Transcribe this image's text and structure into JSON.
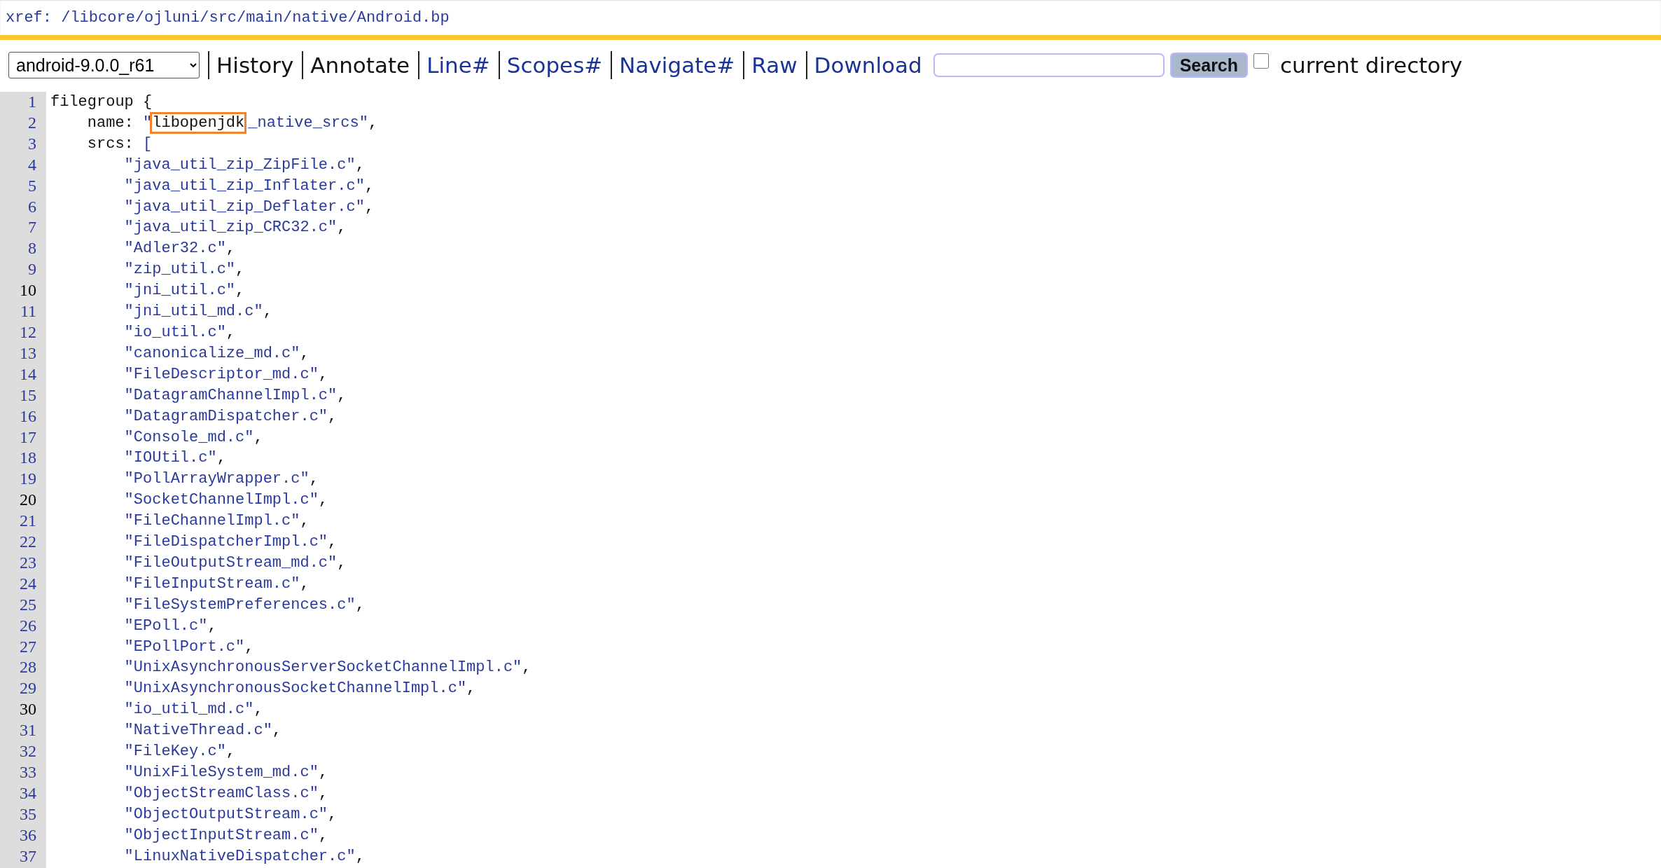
{
  "xref_path": "xref: /libcore/ojluni/src/main/native/Android.bp",
  "toolbar": {
    "version_select": {
      "value": "android-9.0.0_r61"
    },
    "links": [
      {
        "label": "History",
        "kind": "plain"
      },
      {
        "label": "Annotate",
        "kind": "plain"
      },
      {
        "label": "Line#",
        "kind": "link"
      },
      {
        "label": "Scopes#",
        "kind": "link"
      },
      {
        "label": "Navigate#",
        "kind": "link"
      },
      {
        "label": "Raw",
        "kind": "link"
      },
      {
        "label": "Download",
        "kind": "link"
      }
    ],
    "search": {
      "button": "Search"
    },
    "current_directory": {
      "label": "current directory",
      "checked": false
    }
  },
  "code": [
    {
      "number": "1",
      "major": false,
      "tokens": [
        {
          "kind": "plain",
          "text": "filegroup {"
        }
      ]
    },
    {
      "number": "2",
      "major": false,
      "tokens": [
        {
          "kind": "plain",
          "text": "    name: "
        },
        {
          "kind": "string",
          "text": "\""
        },
        {
          "kind": "highlight",
          "text": "libopenjdk"
        },
        {
          "kind": "string",
          "text": "_native_srcs\""
        },
        {
          "kind": "plain",
          "text": ","
        }
      ]
    },
    {
      "number": "3",
      "major": false,
      "tokens": [
        {
          "kind": "plain",
          "text": "    srcs: "
        },
        {
          "kind": "string",
          "text": "["
        }
      ]
    },
    {
      "number": "4",
      "major": false,
      "tokens": [
        {
          "kind": "string",
          "text": "        \"java_util_zip_ZipFile.c\""
        },
        {
          "kind": "plain",
          "text": ","
        }
      ]
    },
    {
      "number": "5",
      "major": false,
      "tokens": [
        {
          "kind": "string",
          "text": "        \"java_util_zip_Inflater.c\""
        },
        {
          "kind": "plain",
          "text": ","
        }
      ]
    },
    {
      "number": "6",
      "major": false,
      "tokens": [
        {
          "kind": "string",
          "text": "        \"java_util_zip_Deflater.c\""
        },
        {
          "kind": "plain",
          "text": ","
        }
      ]
    },
    {
      "number": "7",
      "major": false,
      "tokens": [
        {
          "kind": "string",
          "text": "        \"java_util_zip_CRC32.c\""
        },
        {
          "kind": "plain",
          "text": ","
        }
      ]
    },
    {
      "number": "8",
      "major": false,
      "tokens": [
        {
          "kind": "string",
          "text": "        \"Adler32.c\""
        },
        {
          "kind": "plain",
          "text": ","
        }
      ]
    },
    {
      "number": "9",
      "major": false,
      "tokens": [
        {
          "kind": "string",
          "text": "        \"zip_util.c\""
        },
        {
          "kind": "plain",
          "text": ","
        }
      ]
    },
    {
      "number": "10",
      "major": true,
      "tokens": [
        {
          "kind": "string",
          "text": "        \"jni_util.c\""
        },
        {
          "kind": "plain",
          "text": ","
        }
      ]
    },
    {
      "number": "11",
      "major": false,
      "tokens": [
        {
          "kind": "string",
          "text": "        \"jni_util_md.c\""
        },
        {
          "kind": "plain",
          "text": ","
        }
      ]
    },
    {
      "number": "12",
      "major": false,
      "tokens": [
        {
          "kind": "string",
          "text": "        \"io_util.c\""
        },
        {
          "kind": "plain",
          "text": ","
        }
      ]
    },
    {
      "number": "13",
      "major": false,
      "tokens": [
        {
          "kind": "string",
          "text": "        \"canonicalize_md.c\""
        },
        {
          "kind": "plain",
          "text": ","
        }
      ]
    },
    {
      "number": "14",
      "major": false,
      "tokens": [
        {
          "kind": "string",
          "text": "        \"FileDescriptor_md.c\""
        },
        {
          "kind": "plain",
          "text": ","
        }
      ]
    },
    {
      "number": "15",
      "major": false,
      "tokens": [
        {
          "kind": "string",
          "text": "        \"DatagramChannelImpl.c\""
        },
        {
          "kind": "plain",
          "text": ","
        }
      ]
    },
    {
      "number": "16",
      "major": false,
      "tokens": [
        {
          "kind": "string",
          "text": "        \"DatagramDispatcher.c\""
        },
        {
          "kind": "plain",
          "text": ","
        }
      ]
    },
    {
      "number": "17",
      "major": false,
      "tokens": [
        {
          "kind": "string",
          "text": "        \"Console_md.c\""
        },
        {
          "kind": "plain",
          "text": ","
        }
      ]
    },
    {
      "number": "18",
      "major": false,
      "tokens": [
        {
          "kind": "string",
          "text": "        \"IOUtil.c\""
        },
        {
          "kind": "plain",
          "text": ","
        }
      ]
    },
    {
      "number": "19",
      "major": false,
      "tokens": [
        {
          "kind": "string",
          "text": "        \"PollArrayWrapper.c\""
        },
        {
          "kind": "plain",
          "text": ","
        }
      ]
    },
    {
      "number": "20",
      "major": true,
      "tokens": [
        {
          "kind": "string",
          "text": "        \"SocketChannelImpl.c\""
        },
        {
          "kind": "plain",
          "text": ","
        }
      ]
    },
    {
      "number": "21",
      "major": false,
      "tokens": [
        {
          "kind": "string",
          "text": "        \"FileChannelImpl.c\""
        },
        {
          "kind": "plain",
          "text": ","
        }
      ]
    },
    {
      "number": "22",
      "major": false,
      "tokens": [
        {
          "kind": "string",
          "text": "        \"FileDispatcherImpl.c\""
        },
        {
          "kind": "plain",
          "text": ","
        }
      ]
    },
    {
      "number": "23",
      "major": false,
      "tokens": [
        {
          "kind": "string",
          "text": "        \"FileOutputStream_md.c\""
        },
        {
          "kind": "plain",
          "text": ","
        }
      ]
    },
    {
      "number": "24",
      "major": false,
      "tokens": [
        {
          "kind": "string",
          "text": "        \"FileInputStream.c\""
        },
        {
          "kind": "plain",
          "text": ","
        }
      ]
    },
    {
      "number": "25",
      "major": false,
      "tokens": [
        {
          "kind": "string",
          "text": "        \"FileSystemPreferences.c\""
        },
        {
          "kind": "plain",
          "text": ","
        }
      ]
    },
    {
      "number": "26",
      "major": false,
      "tokens": [
        {
          "kind": "string",
          "text": "        \"EPoll.c\""
        },
        {
          "kind": "plain",
          "text": ","
        }
      ]
    },
    {
      "number": "27",
      "major": false,
      "tokens": [
        {
          "kind": "string",
          "text": "        \"EPollPort.c\""
        },
        {
          "kind": "plain",
          "text": ","
        }
      ]
    },
    {
      "number": "28",
      "major": false,
      "tokens": [
        {
          "kind": "string",
          "text": "        \"UnixAsynchronousServerSocketChannelImpl.c\""
        },
        {
          "kind": "plain",
          "text": ","
        }
      ]
    },
    {
      "number": "29",
      "major": false,
      "tokens": [
        {
          "kind": "string",
          "text": "        \"UnixAsynchronousSocketChannelImpl.c\""
        },
        {
          "kind": "plain",
          "text": ","
        }
      ]
    },
    {
      "number": "30",
      "major": true,
      "tokens": [
        {
          "kind": "string",
          "text": "        \"io_util_md.c\""
        },
        {
          "kind": "plain",
          "text": ","
        }
      ]
    },
    {
      "number": "31",
      "major": false,
      "tokens": [
        {
          "kind": "string",
          "text": "        \"NativeThread.c\""
        },
        {
          "kind": "plain",
          "text": ","
        }
      ]
    },
    {
      "number": "32",
      "major": false,
      "tokens": [
        {
          "kind": "string",
          "text": "        \"FileKey.c\""
        },
        {
          "kind": "plain",
          "text": ","
        }
      ]
    },
    {
      "number": "33",
      "major": false,
      "tokens": [
        {
          "kind": "string",
          "text": "        \"UnixFileSystem_md.c\""
        },
        {
          "kind": "plain",
          "text": ","
        }
      ]
    },
    {
      "number": "34",
      "major": false,
      "tokens": [
        {
          "kind": "string",
          "text": "        \"ObjectStreamClass.c\""
        },
        {
          "kind": "plain",
          "text": ","
        }
      ]
    },
    {
      "number": "35",
      "major": false,
      "tokens": [
        {
          "kind": "string",
          "text": "        \"ObjectOutputStream.c\""
        },
        {
          "kind": "plain",
          "text": ","
        }
      ]
    },
    {
      "number": "36",
      "major": false,
      "tokens": [
        {
          "kind": "string",
          "text": "        \"ObjectInputStream.c\""
        },
        {
          "kind": "plain",
          "text": ","
        }
      ]
    },
    {
      "number": "37",
      "major": false,
      "tokens": [
        {
          "kind": "string",
          "text": "        \"LinuxNativeDispatcher.c\""
        },
        {
          "kind": "plain",
          "text": ","
        }
      ]
    }
  ]
}
